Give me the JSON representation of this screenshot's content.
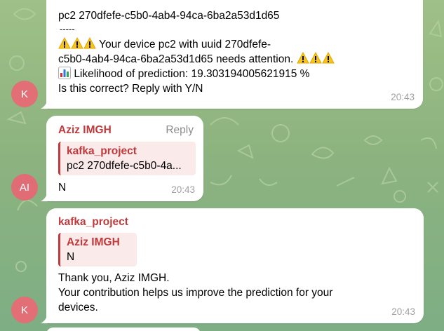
{
  "colors": {
    "accent_name": "#c0393b",
    "time_gray": "#a0a0a0",
    "avatar_k": "#e26f76",
    "avatar_ai": "#e06c75"
  },
  "messages": [
    {
      "sender_avatar": "K",
      "line1": "pc2 270dfefe-c5b0-4ab4-94ca-6ba2a53d1d65",
      "line2": "-----",
      "line3": "Your device pc2 with uuid 270dfefe-",
      "line4": "c5b0-4ab4-94ca-6ba2a53d1d65 needs attention.",
      "line5": "Likelihood of prediction: 19.303194005621915 %",
      "line6": "Is this correct? Reply with Y/N",
      "time": "20:43",
      "icons": [
        "warning-emoji",
        "bar-chart-emoji"
      ]
    },
    {
      "sender_avatar": "AI",
      "sender": "Aziz IMGH",
      "reply_label": "Reply",
      "quote_sender": "kafka_project",
      "quote_text": "pc2 270dfefe-c5b0-4a...",
      "text": "N",
      "time": "20:43"
    },
    {
      "sender_avatar": "K",
      "sender": "kafka_project",
      "quote_sender": "Aziz IMGH",
      "quote_text": "N",
      "line1": "Thank you, Aziz IMGH.",
      "line2": "Your contribution helps us improve the prediction for your",
      "line3": "devices.",
      "time": "20:43"
    }
  ]
}
